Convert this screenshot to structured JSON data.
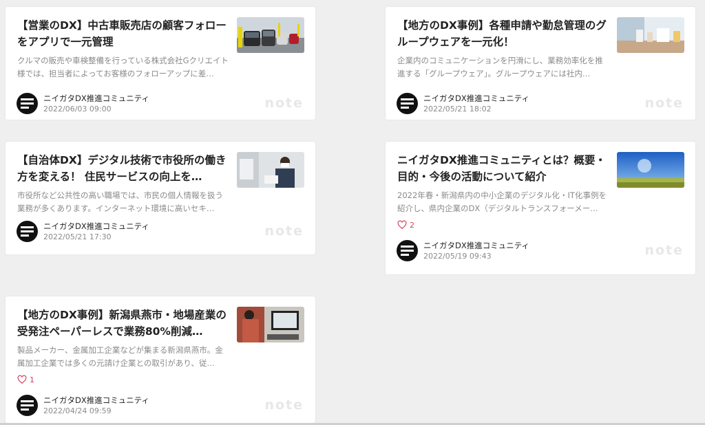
{
  "cards": [
    {
      "title": "【営業のDX】中古車販売店の顧客フォローをアプリで一元管理",
      "excerpt": "クルマの販売や車検整備を行っている株式会社Gクリエイト様では、担当者によってお客様のフォローアップに差…",
      "author": "ニイガタDX推進コミュニティ",
      "date": "2022/06/03 09:00",
      "brand": "note",
      "thumbnail_icon": "car-lot-photo"
    },
    {
      "title": "【地方のDX事例】各種申請や勤怠管理のグループウェアを一元化！",
      "excerpt": "企業内のコミュニケーションを円滑にし、業務効率化を推進する「グループウェア」。グループウェアには社内…",
      "author": "ニイガタDX推進コミュニティ",
      "date": "2022/05/21 18:02",
      "brand": "note",
      "thumbnail_icon": "office-desk-photo"
    },
    {
      "title": "【自治体DX】デジタル技術で市役所の働き方を変える！ 住民サービスの向上を…",
      "excerpt": "市役所など公共性の高い職場では、市民の個人情報を扱う業務が多くあります。インターネット環境に高いセキ…",
      "author": "ニイガタDX推進コミュニティ",
      "date": "2022/05/21 17:30",
      "brand": "note",
      "thumbnail_icon": "office-worker-photo"
    },
    {
      "title": "ニイガタDX推進コミュニティとは？概要・目的・今後の活動について紹介",
      "excerpt": "2022年春・新潟県内の中小企業のデジタル化・IT化事例を紹介し、県内企業のDX（デジタルトランスフォーメー…",
      "likes": "2",
      "author": "ニイガタDX推進コミュニティ",
      "date": "2022/05/19 09:43",
      "brand": "note",
      "thumbnail_icon": "sky-field-photo"
    },
    {
      "title": "【地方のDX事例】新潟県燕市・地場産業の受発注ペーパーレスで業務80%削減…",
      "excerpt": "製品メーカー、金属加工企業などが集まる新潟県燕市。金属加工企業では多くの元請け企業との取引があり、従…",
      "likes": "1",
      "author": "ニイガタDX推進コミュニティ",
      "date": "2022/04/24 09:59",
      "brand": "note",
      "thumbnail_icon": "computer-work-photo"
    }
  ],
  "colors": {
    "background": "#efefef",
    "card": "#ffffff",
    "title": "#222222",
    "muted": "#8a8a8a",
    "like": "#d4405a",
    "brand_watermark": "#e7e7e7"
  }
}
